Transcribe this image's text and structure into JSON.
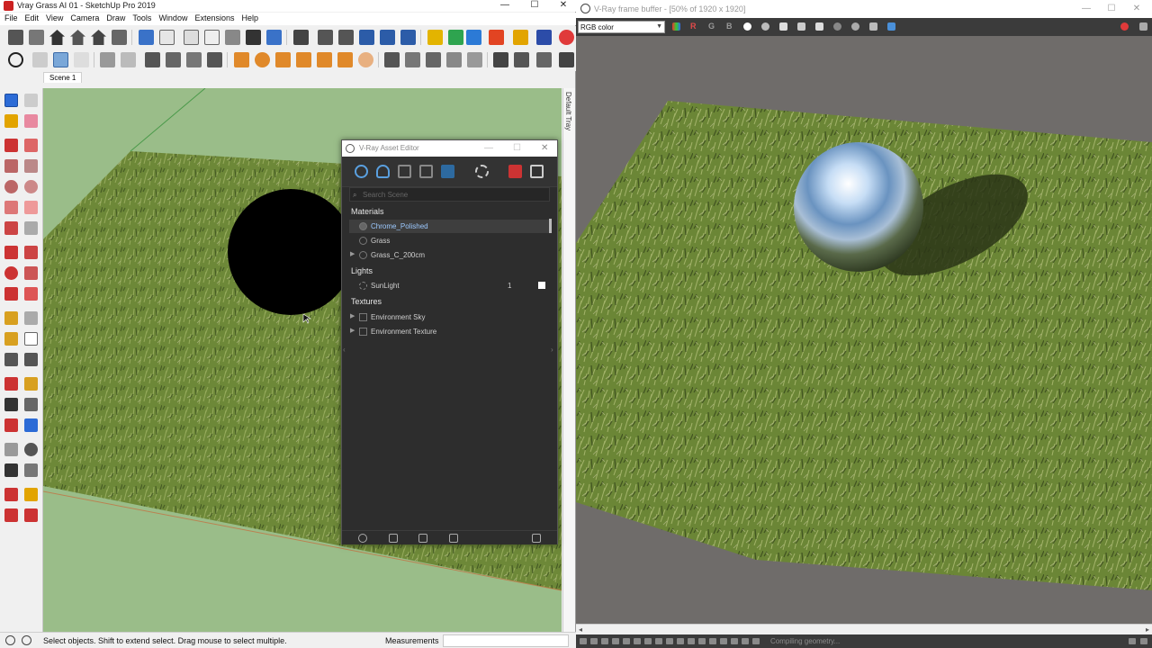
{
  "sketchup": {
    "title": "Vray Grass AI 01 - SketchUp Pro 2019",
    "menu": [
      "File",
      "Edit",
      "View",
      "Camera",
      "Draw",
      "Tools",
      "Window",
      "Extensions",
      "Help"
    ],
    "scene_tab": "Scene 1",
    "default_tray": "Default Tray",
    "status_message": "Select objects. Shift to extend select. Drag mouse to select multiple.",
    "measurements_label": "Measurements",
    "measurements_value": ""
  },
  "asset_editor": {
    "title": "V-Ray Asset Editor",
    "search_placeholder": "Search Scene",
    "categories": {
      "materials": "Materials",
      "lights": "Lights",
      "textures": "Textures"
    },
    "materials": [
      "Chrome_Polished",
      "Grass",
      "Grass_C_200cm"
    ],
    "selected_material": "Chrome_Polished",
    "lights": [
      {
        "name": "SunLight",
        "count": "1"
      }
    ],
    "textures": [
      "Environment Sky",
      "Environment Texture"
    ]
  },
  "frame_buffer": {
    "title": "V-Ray frame buffer - [50% of 1920 x 1920]",
    "channel": "RGB color",
    "channel_buttons": {
      "r": "R",
      "g": "G",
      "b": "B"
    },
    "status": "Compiling geometry..."
  },
  "colors": {
    "grass": "#6f8a3a",
    "ground_plane": "#9abd89",
    "vfb_background": "#6f6c6a",
    "asset_editor_bg": "#2d2d2d",
    "vray_red": "#e03a3a"
  }
}
